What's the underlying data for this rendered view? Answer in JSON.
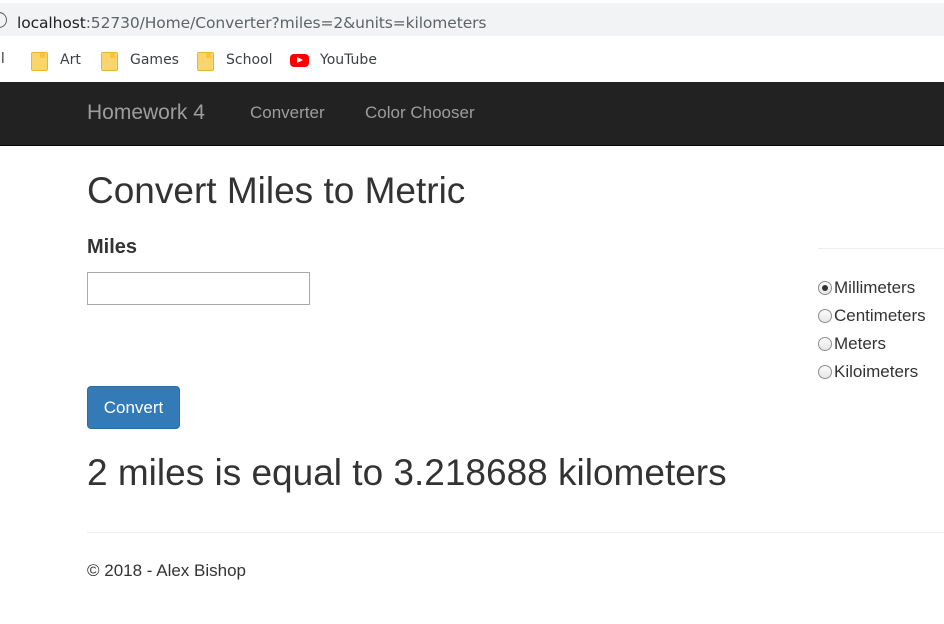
{
  "browser": {
    "url_host": "localhost",
    "url_path": ":52730/Home/Converter?miles=2&units=kilometers",
    "bookmarks": [
      {
        "label": "il",
        "icon": "cut-off"
      },
      {
        "label": "Art",
        "icon": "folder-icon"
      },
      {
        "label": "Games",
        "icon": "folder-icon"
      },
      {
        "label": "School",
        "icon": "folder-icon"
      },
      {
        "label": "YouTube",
        "icon": "youtube-icon"
      }
    ]
  },
  "navbar": {
    "brand": "Homework 4",
    "links": [
      "Converter",
      "Color Chooser"
    ]
  },
  "main": {
    "title": "Convert Miles to Metric",
    "miles_label": "Miles",
    "miles_value": "",
    "units": [
      {
        "label": "Millimeters",
        "checked": true
      },
      {
        "label": "Centimeters",
        "checked": false
      },
      {
        "label": "Meters",
        "checked": false
      },
      {
        "label": "Kiloimeters",
        "checked": false
      }
    ],
    "convert_label": "Convert",
    "result": "2 miles is equal to 3.218688 kilometers"
  },
  "footer": {
    "text": "© 2018 - Alex Bishop"
  },
  "colors": {
    "navbar_bg": "#222222",
    "nav_text": "#9d9d9d",
    "button_primary": "#337ab7",
    "text": "#333333"
  }
}
